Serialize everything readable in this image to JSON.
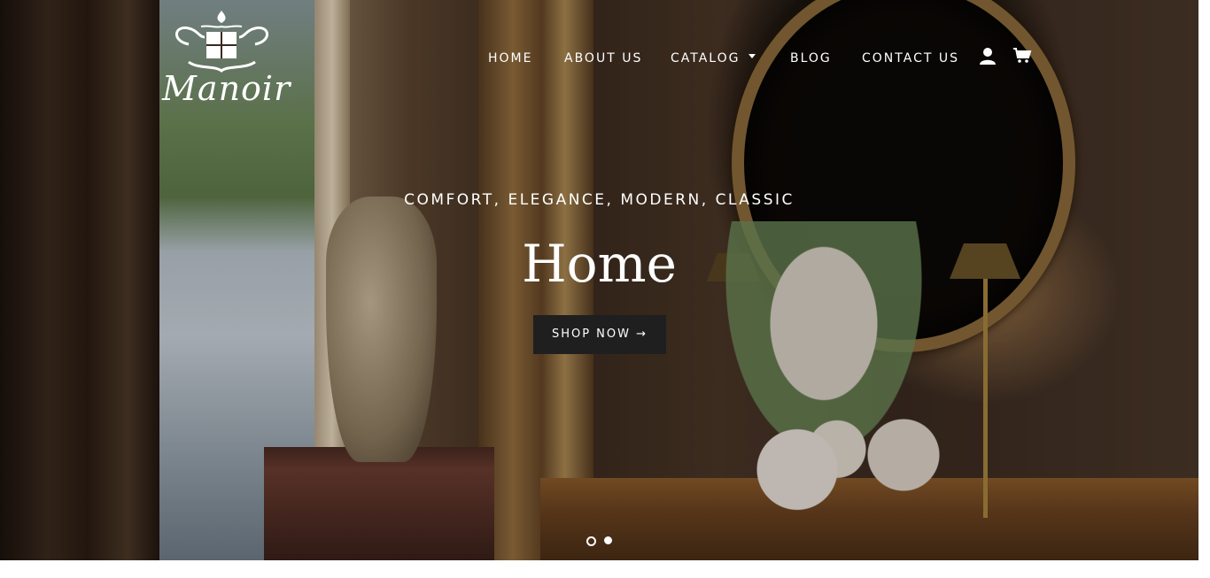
{
  "brand": {
    "logo_text": "Manoir"
  },
  "nav": {
    "items": [
      {
        "label": "HOME"
      },
      {
        "label": "ABOUT US"
      },
      {
        "label": "CATALOG"
      },
      {
        "label": "BLOG"
      },
      {
        "label": "CONTACT US"
      }
    ],
    "account_icon": "user-icon",
    "cart_icon": "cart-icon"
  },
  "hero": {
    "eyebrow": "COMFORT, ELEGANCE, MODERN, CLASSIC",
    "title": "Home",
    "cta_label": "SHOP NOW →",
    "slide_count": 2,
    "active_slide": 1
  },
  "colors": {
    "cta_bg": "#1f1f1f",
    "text": "#ffffff"
  }
}
